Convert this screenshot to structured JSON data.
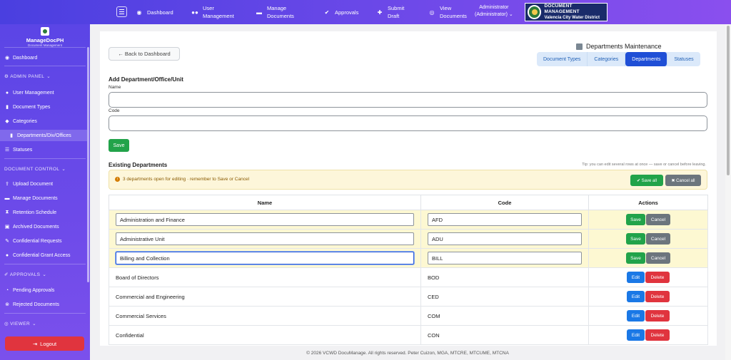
{
  "topnav": {
    "items": [
      {
        "label": "Dashboard",
        "icon": "palette-icon"
      },
      {
        "label": "User\nManagement",
        "icon": "users-icon"
      },
      {
        "label": "Manage\nDocuments",
        "icon": "folder-icon"
      },
      {
        "label": "Approvals",
        "icon": "check-circle-icon"
      },
      {
        "label": "Submit\nDraft",
        "icon": "user-plus-icon"
      },
      {
        "label": "View\nDocuments",
        "icon": "eye-icon"
      }
    ],
    "user_name": "Administrator",
    "user_role": "(Administrator)",
    "brand_line1": "DOCUMENT MANAGEMENT",
    "brand_line2": "Valencia City Water District"
  },
  "sidebar": {
    "app_name": "ManageDocPH",
    "app_tagline": "Document Management",
    "dashboard": "Dashboard",
    "admin_panel": "ADMIN PANEL",
    "admin_items": [
      "User Management",
      "Document Types",
      "Categories",
      "Departments/Div/Offices",
      "Statuses"
    ],
    "document_control": "DOCUMENT CONTROL",
    "doc_items": [
      "Upload Document",
      "Manage Documents",
      "Retention Schedule",
      "Archived Documents",
      "Confidential Requests",
      "Confidential Grant Access"
    ],
    "approvals": "APPROVALS",
    "approval_items": [
      "Pending Approvals",
      "Rejected Documents"
    ],
    "viewer": "VIEWER",
    "logout": "Logout"
  },
  "main": {
    "back_label": "← Back to Dashboard",
    "title": "Departments Maintenance",
    "tabs": [
      "Document Types",
      "Categories",
      "Departments",
      "Statuses"
    ],
    "active_tab": "Departments",
    "add_heading": "Add Department/Office/Unit",
    "name_label": "Name",
    "code_label": "Code",
    "save_label": "Save",
    "existing_heading": "Existing Departments",
    "tip": "Tip: you can edit several rows at once — save or cancel before leaving.",
    "alert_text": "3 departments open for editing · remember to Save or Cancel",
    "save_all": "✔ Save all",
    "cancel_all": "✖ Cancel all",
    "table": {
      "headers": [
        "Name",
        "Code",
        "Actions"
      ],
      "rows": [
        {
          "name": "Administration and Finance",
          "code": "AFD",
          "editing": true
        },
        {
          "name": "Administrative Unit",
          "code": "ADU",
          "editing": true
        },
        {
          "name": "Billing and Collection",
          "code": "BILL",
          "editing": true
        },
        {
          "name": "Board of Directors",
          "code": "BOD",
          "editing": false
        },
        {
          "name": "Commercial and Engineering",
          "code": "CED",
          "editing": false
        },
        {
          "name": "Commercial Services",
          "code": "COM",
          "editing": false
        },
        {
          "name": "Confidential",
          "code": "CON",
          "editing": false
        }
      ],
      "save": "Save",
      "cancel": "Cancel",
      "edit": "Edit",
      "delete": "Delete"
    }
  },
  "footer": "© 2026 VCWD DocuManage. All rights reserved. Peter Cuizon, MGA, MTCRE, MTCUME, MTCNA"
}
